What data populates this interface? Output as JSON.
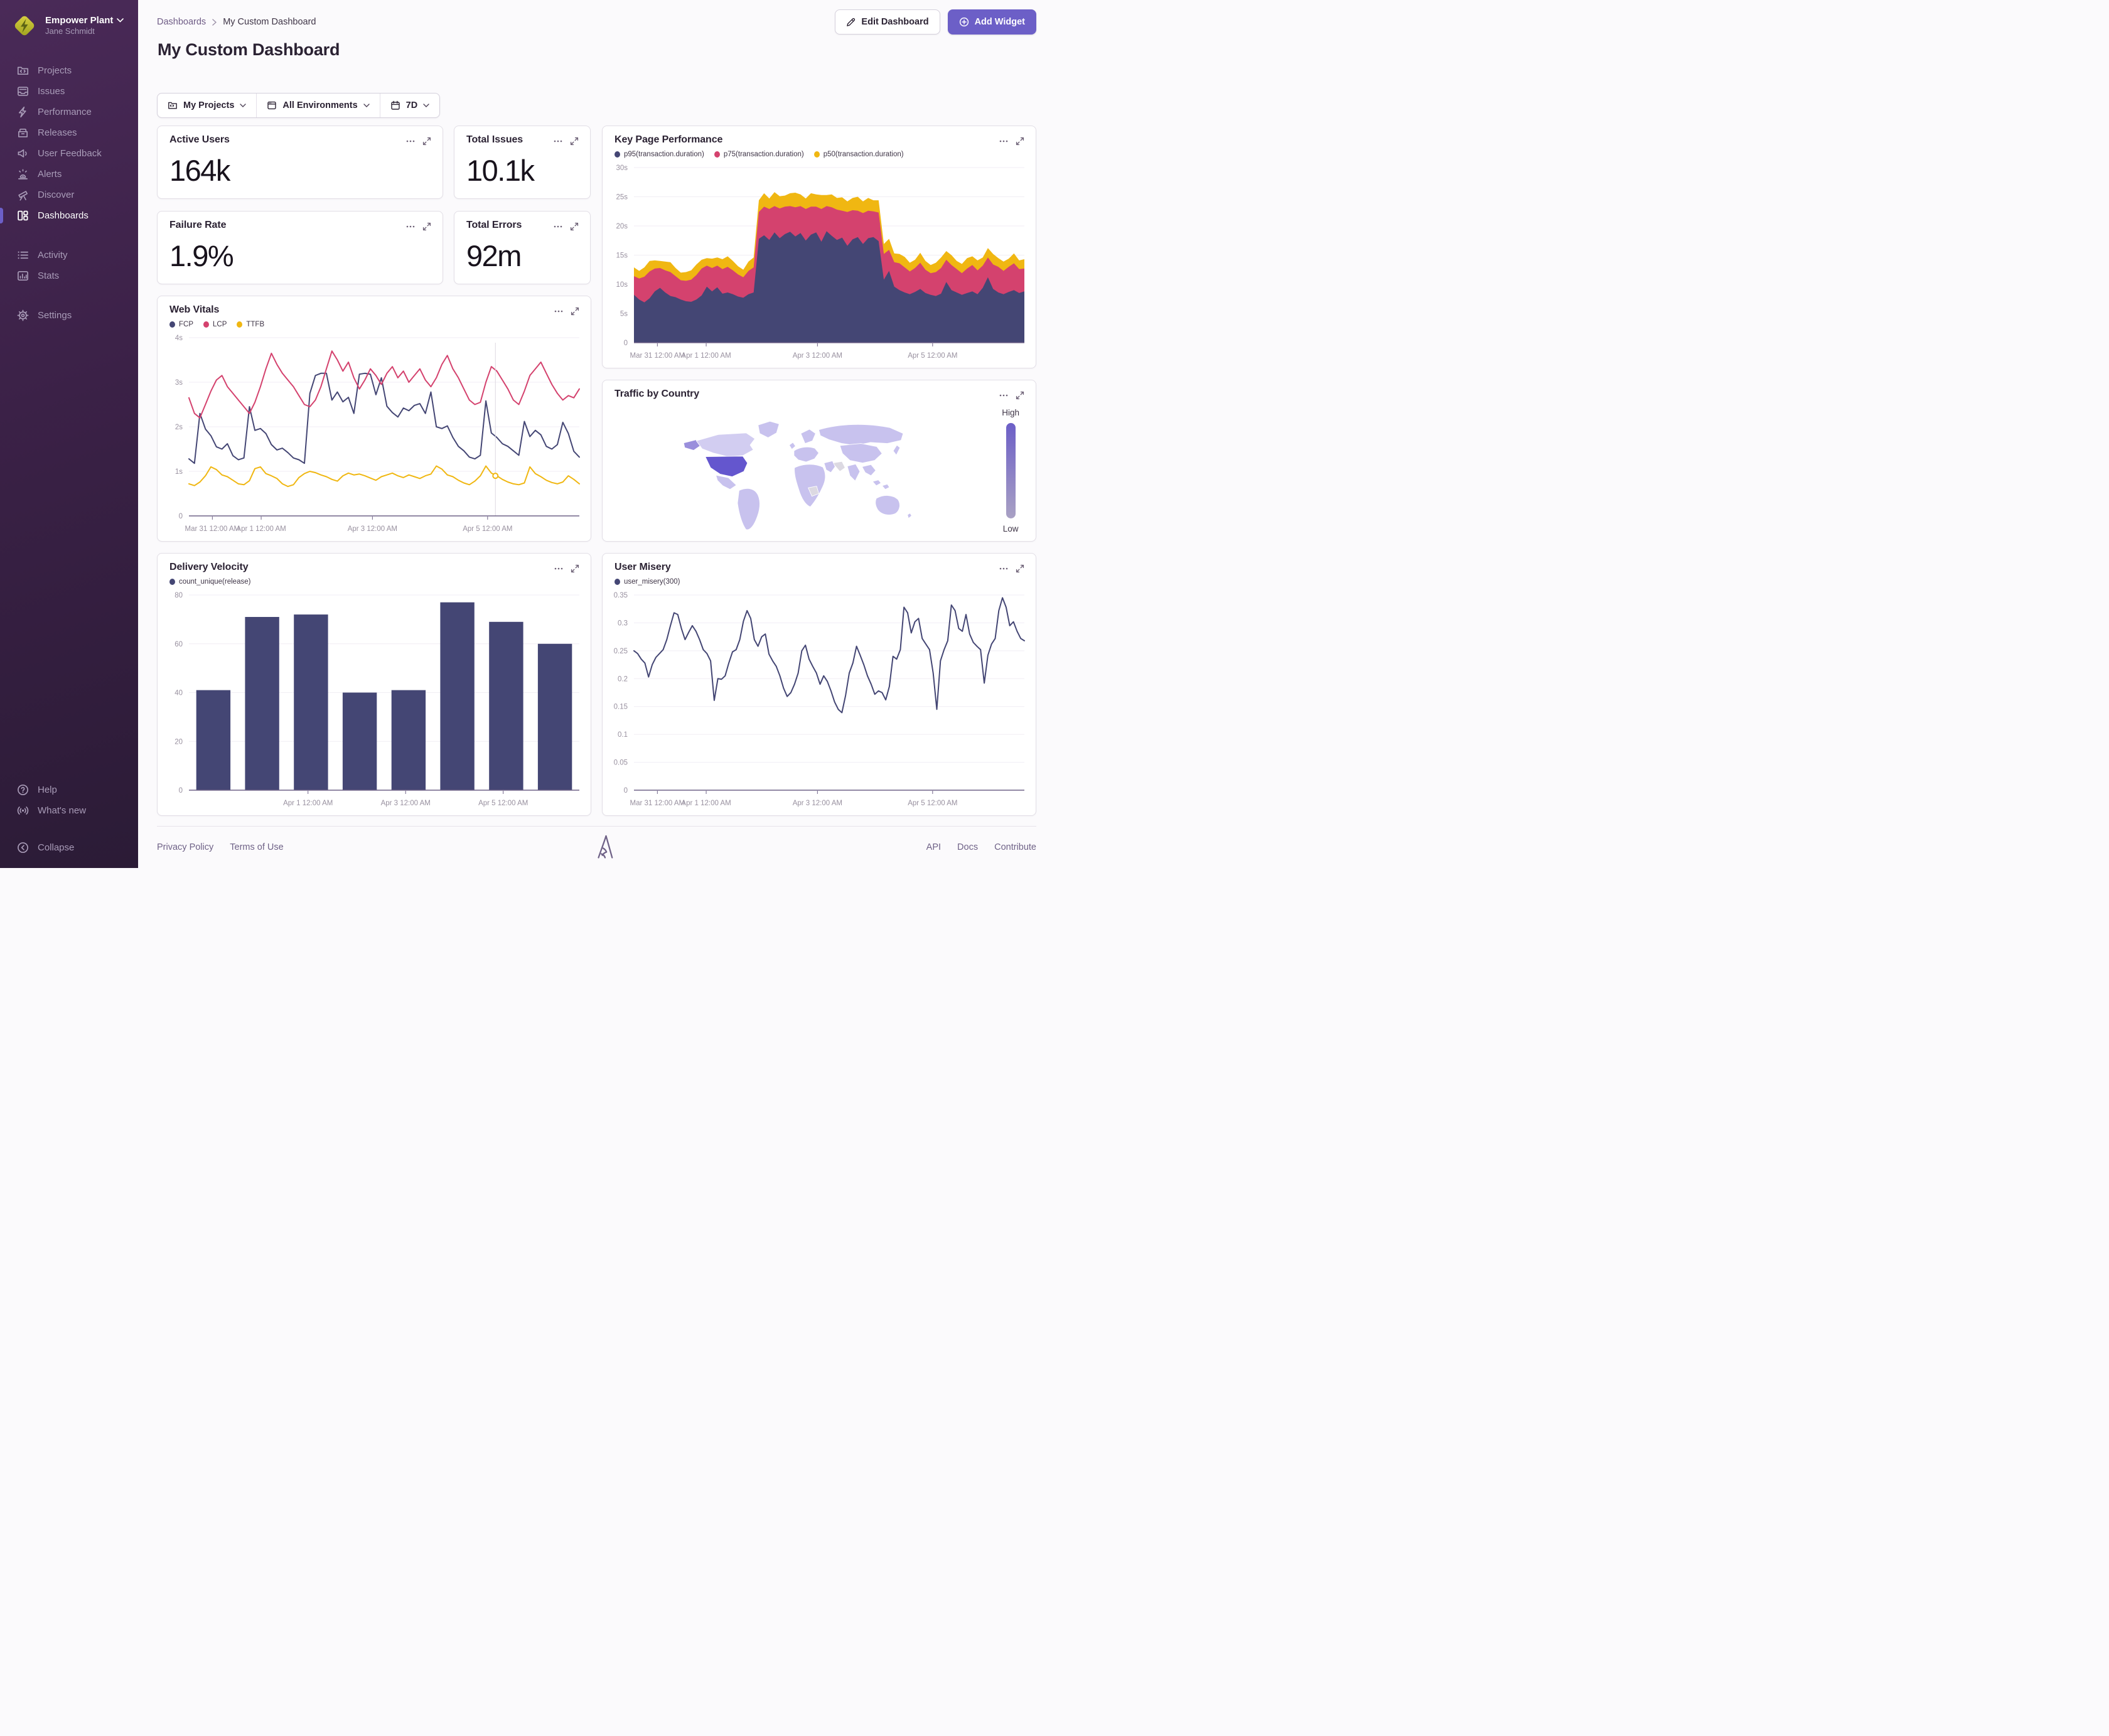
{
  "colors": {
    "accent": "#6C5FC7",
    "series_navy": "#444674",
    "series_pink": "#D4426E",
    "series_gold": "#F0B712",
    "map_base": "#C8C2EE",
    "map_light": "#D2CDF1",
    "map_medium": "#9A8FDC",
    "map_high": "#6456CE",
    "map_gray": "#DCD9E2",
    "legend_high": "#6C5FC7",
    "legend_low": "#A9A1C4"
  },
  "sidebar": {
    "org_name": "Empower Plant",
    "user_name": "Jane Schmidt",
    "items": [
      {
        "label": "Projects"
      },
      {
        "label": "Issues"
      },
      {
        "label": "Performance"
      },
      {
        "label": "Releases"
      },
      {
        "label": "User Feedback"
      },
      {
        "label": "Alerts"
      },
      {
        "label": "Discover"
      },
      {
        "label": "Dashboards",
        "active": true
      },
      {
        "label": "Activity"
      },
      {
        "label": "Stats"
      },
      {
        "label": "Settings"
      }
    ],
    "footer_items": [
      {
        "label": "Help"
      },
      {
        "label": "What's new"
      },
      {
        "label": "Collapse"
      }
    ]
  },
  "header": {
    "breadcrumb_parent": "Dashboards",
    "breadcrumb_current": "My Custom Dashboard",
    "title": "My Custom Dashboard",
    "edit_button": "Edit Dashboard",
    "add_button": "Add Widget"
  },
  "filters": {
    "projects": "My Projects",
    "environments": "All Environments",
    "date_range": "7D"
  },
  "widgets": {
    "active_users": {
      "title": "Active Users",
      "value": "164k"
    },
    "total_issues": {
      "title": "Total Issues",
      "value": "10.1k"
    },
    "failure_rate": {
      "title": "Failure Rate",
      "value": "1.9%"
    },
    "total_errors": {
      "title": "Total Errors",
      "value": "92m"
    }
  },
  "chart_data": [
    {
      "id": "key_page_performance",
      "title": "Key Page Performance",
      "type": "area",
      "stacked": true,
      "ylim": [
        0,
        30
      ],
      "y_ticks": [
        {
          "v": 0,
          "label": "0"
        },
        {
          "v": 5,
          "label": "5s"
        },
        {
          "v": 10,
          "label": "10s"
        },
        {
          "v": 15,
          "label": "15s"
        },
        {
          "v": 20,
          "label": "20s"
        },
        {
          "v": 25,
          "label": "25s"
        },
        {
          "v": 30,
          "label": "30s"
        }
      ],
      "x_ticks": [
        {
          "f": 0.06,
          "label": "Mar 31 12:00 AM"
        },
        {
          "f": 0.185,
          "label": "Apr 1 12:00 AM"
        },
        {
          "f": 0.47,
          "label": "Apr 3 12:00 AM"
        },
        {
          "f": 0.765,
          "label": "Apr 5 12:00 AM"
        }
      ],
      "series": [
        {
          "name": "p95(transaction.duration)",
          "color": "#444674",
          "values": [
            8.2,
            7.4,
            6.9,
            7.6,
            8.8,
            9.4,
            8.6,
            8.0,
            7.8,
            7.4,
            7.1,
            7.0,
            7.4,
            8.1,
            9.6,
            8.8,
            9.5,
            8.4,
            8.6,
            8.3,
            7.9,
            7.7,
            8.3,
            8.6,
            17.8,
            18.4,
            17.6,
            18.9,
            17.9,
            18.6,
            19.0,
            18.2,
            18.8,
            17.5,
            18.5,
            18.9,
            17.3,
            19.1,
            18.3,
            17.6,
            18.0,
            16.6,
            17.7,
            18.1,
            16.9,
            17.9,
            18.1,
            17.4,
            10.8,
            12.3,
            9.6,
            9.0,
            8.6,
            8.3,
            8.7,
            9.2,
            8.5,
            8.2,
            8.0,
            8.4,
            10.4,
            9.0,
            8.6,
            8.2,
            8.5,
            8.8,
            8.3,
            9.4,
            11.2,
            9.2,
            8.6,
            8.3,
            8.7,
            9.0,
            8.5,
            8.8
          ]
        },
        {
          "name": "p75(transaction.duration)",
          "color": "#D4426E",
          "values": [
            3.2,
            3.6,
            4.4,
            4.6,
            3.9,
            3.4,
            3.8,
            4.1,
            3.6,
            3.3,
            3.5,
            3.8,
            4.2,
            4.6,
            3.6,
            4.0,
            3.7,
            4.2,
            4.4,
            4.1,
            3.8,
            3.5,
            4.0,
            4.3,
            4.6,
            4.9,
            5.3,
            4.5,
            5.1,
            4.7,
            4.4,
            5.0,
            4.6,
            5.4,
            4.8,
            4.4,
            5.6,
            4.3,
            4.9,
            5.2,
            4.6,
            5.8,
            5.0,
            4.5,
            5.3,
            4.7,
            4.4,
            4.9,
            4.4,
            3.6,
            4.2,
            4.6,
            4.3,
            3.9,
            4.1,
            4.5,
            4.0,
            3.7,
            4.1,
            4.4,
            3.8,
            4.3,
            4.0,
            3.7,
            4.2,
            4.5,
            4.1,
            3.8,
            3.4,
            4.2,
            4.4,
            4.0,
            4.3,
            4.6,
            4.1,
            3.9
          ]
        },
        {
          "name": "p50(transaction.duration)",
          "color": "#F0B712",
          "values": [
            1.5,
            1.3,
            1.6,
            1.8,
            1.4,
            1.2,
            1.5,
            1.7,
            1.4,
            1.3,
            1.5,
            1.6,
            1.8,
            1.5,
            1.3,
            1.6,
            1.4,
            1.7,
            1.8,
            1.6,
            1.4,
            1.3,
            1.6,
            1.7,
            2.0,
            2.3,
            1.8,
            2.4,
            2.1,
            1.9,
            2.2,
            2.5,
            2.0,
            1.8,
            2.3,
            2.1,
            2.4,
            1.9,
            2.2,
            2.0,
            2.3,
            1.8,
            2.1,
            2.4,
            2.0,
            2.2,
            1.9,
            2.1,
            1.7,
            1.9,
            1.5,
            1.6,
            1.8,
            1.5,
            1.4,
            1.7,
            1.5,
            1.4,
            1.6,
            1.8,
            1.5,
            1.7,
            1.4,
            1.6,
            1.8,
            1.5,
            1.7,
            1.4,
            1.6,
            1.8,
            1.5,
            1.6,
            1.4,
            1.7,
            1.5,
            1.6
          ]
        }
      ]
    },
    {
      "id": "web_vitals",
      "title": "Web Vitals",
      "type": "line",
      "ylim": [
        0,
        4
      ],
      "y_ticks": [
        {
          "v": 0,
          "label": "0"
        },
        {
          "v": 1,
          "label": "1s"
        },
        {
          "v": 2,
          "label": "2s"
        },
        {
          "v": 3,
          "label": "3s"
        },
        {
          "v": 4,
          "label": "4s"
        }
      ],
      "x_ticks": [
        {
          "f": 0.06,
          "label": "Mar 31 12:00 AM"
        },
        {
          "f": 0.185,
          "label": "Apr 1 12:00 AM"
        },
        {
          "f": 0.47,
          "label": "Apr 3 12:00 AM"
        },
        {
          "f": 0.765,
          "label": "Apr 5 12:00 AM"
        }
      ],
      "cursor": {
        "f": 0.785,
        "series": 2
      },
      "series": [
        {
          "name": "FCP",
          "color": "#444674",
          "values": [
            1.28,
            1.18,
            2.3,
            1.95,
            1.8,
            1.55,
            1.5,
            1.62,
            1.35,
            1.26,
            1.3,
            2.45,
            1.92,
            1.96,
            1.85,
            1.6,
            1.48,
            1.52,
            1.42,
            1.3,
            1.26,
            1.18,
            2.75,
            3.15,
            3.2,
            3.2,
            2.6,
            2.78,
            2.56,
            2.66,
            2.3,
            3.18,
            3.2,
            3.18,
            2.72,
            3.1,
            2.46,
            2.32,
            2.22,
            2.42,
            2.36,
            2.48,
            2.52,
            2.3,
            2.78,
            2.0,
            1.96,
            2.02,
            1.76,
            1.56,
            1.46,
            1.32,
            1.28,
            1.36,
            2.58,
            1.86,
            1.76,
            1.62,
            1.56,
            1.46,
            1.36,
            2.12,
            1.78,
            1.92,
            1.82,
            1.56,
            1.5,
            1.6,
            2.1,
            1.85,
            1.45,
            1.32
          ]
        },
        {
          "name": "LCP",
          "color": "#D4426E",
          "values": [
            2.65,
            2.3,
            2.2,
            2.5,
            2.8,
            3.05,
            3.15,
            2.9,
            2.75,
            2.6,
            2.45,
            2.3,
            2.55,
            2.9,
            3.3,
            3.65,
            3.4,
            3.2,
            3.05,
            2.9,
            2.7,
            2.5,
            2.45,
            2.6,
            2.9,
            3.3,
            3.7,
            3.5,
            3.25,
            3.45,
            3.1,
            2.85,
            3.05,
            3.3,
            3.15,
            2.95,
            3.2,
            3.35,
            3.1,
            3.25,
            3.0,
            3.15,
            3.3,
            3.05,
            2.9,
            3.1,
            3.4,
            3.6,
            3.3,
            3.1,
            2.85,
            2.6,
            2.5,
            2.55,
            3.0,
            3.35,
            3.25,
            3.05,
            2.85,
            2.6,
            2.5,
            2.8,
            3.15,
            3.3,
            3.45,
            3.2,
            2.95,
            2.75,
            2.6,
            2.7,
            2.65,
            2.85
          ]
        },
        {
          "name": "TTFB",
          "color": "#F0B712",
          "values": [
            0.72,
            0.68,
            0.76,
            0.9,
            1.1,
            1.04,
            0.92,
            0.88,
            0.8,
            0.72,
            0.7,
            0.79,
            1.06,
            1.1,
            0.95,
            0.9,
            0.84,
            0.72,
            0.66,
            0.7,
            0.86,
            0.95,
            1.0,
            0.97,
            0.92,
            0.88,
            0.82,
            0.78,
            0.9,
            0.96,
            0.92,
            0.94,
            0.9,
            0.85,
            0.8,
            0.88,
            0.92,
            0.96,
            0.9,
            0.86,
            0.92,
            0.88,
            0.84,
            0.9,
            0.94,
            1.12,
            1.05,
            0.92,
            0.88,
            0.8,
            0.74,
            0.7,
            0.78,
            0.9,
            1.12,
            0.96,
            0.9,
            0.82,
            0.76,
            0.72,
            0.7,
            0.74,
            1.1,
            0.95,
            0.88,
            0.8,
            0.75,
            0.72,
            0.76,
            0.9,
            0.82,
            0.72
          ]
        }
      ]
    },
    {
      "id": "traffic_by_country",
      "title": "Traffic by Country",
      "type": "map",
      "legend_high": "High",
      "legend_low": "Low",
      "highlight_country": "United States"
    },
    {
      "id": "delivery_velocity",
      "title": "Delivery Velocity",
      "type": "bar",
      "ylim": [
        0,
        80
      ],
      "y_ticks": [
        {
          "v": 0,
          "label": "0"
        },
        {
          "v": 20,
          "label": "20"
        },
        {
          "v": 40,
          "label": "40"
        },
        {
          "v": 60,
          "label": "60"
        },
        {
          "v": 80,
          "label": "80"
        }
      ],
      "x_ticks": [
        {
          "f": 0.305,
          "label": "Apr 1 12:00 AM"
        },
        {
          "f": 0.555,
          "label": "Apr 3 12:00 AM"
        },
        {
          "f": 0.805,
          "label": "Apr 5 12:00 AM"
        }
      ],
      "series": [
        {
          "name": "count_unique(release)",
          "color": "#444674",
          "values": [
            41,
            71,
            72,
            40,
            41,
            77,
            69,
            60
          ]
        }
      ]
    },
    {
      "id": "user_misery",
      "title": "User Misery",
      "type": "line",
      "ylim": [
        0,
        0.35
      ],
      "y_ticks": [
        {
          "v": 0,
          "label": "0"
        },
        {
          "v": 0.05,
          "label": "0.05"
        },
        {
          "v": 0.1,
          "label": "0.1"
        },
        {
          "v": 0.15,
          "label": "0.15"
        },
        {
          "v": 0.2,
          "label": "0.2"
        },
        {
          "v": 0.25,
          "label": "0.25"
        },
        {
          "v": 0.3,
          "label": "0.3"
        },
        {
          "v": 0.35,
          "label": "0.35"
        }
      ],
      "x_ticks": [
        {
          "f": 0.06,
          "label": "Mar 31 12:00 AM"
        },
        {
          "f": 0.185,
          "label": "Apr 1 12:00 AM"
        },
        {
          "f": 0.47,
          "label": "Apr 3 12:00 AM"
        },
        {
          "f": 0.765,
          "label": "Apr 5 12:00 AM"
        }
      ],
      "series": [
        {
          "name": "user_misery(300)",
          "color": "#444674",
          "values": [
            0.25,
            0.245,
            0.235,
            0.228,
            0.203,
            0.225,
            0.238,
            0.245,
            0.252,
            0.27,
            0.295,
            0.318,
            0.315,
            0.29,
            0.27,
            0.283,
            0.295,
            0.285,
            0.27,
            0.252,
            0.245,
            0.232,
            0.161,
            0.2,
            0.199,
            0.205,
            0.228,
            0.248,
            0.252,
            0.27,
            0.303,
            0.322,
            0.308,
            0.27,
            0.258,
            0.275,
            0.28,
            0.244,
            0.232,
            0.222,
            0.205,
            0.183,
            0.168,
            0.175,
            0.19,
            0.21,
            0.25,
            0.26,
            0.235,
            0.222,
            0.21,
            0.19,
            0.205,
            0.195,
            0.178,
            0.158,
            0.145,
            0.139,
            0.17,
            0.21,
            0.228,
            0.258,
            0.242,
            0.225,
            0.205,
            0.19,
            0.172,
            0.178,
            0.175,
            0.162,
            0.186,
            0.24,
            0.235,
            0.252,
            0.328,
            0.318,
            0.282,
            0.302,
            0.308,
            0.272,
            0.262,
            0.252,
            0.21,
            0.145,
            0.232,
            0.252,
            0.268,
            0.332,
            0.322,
            0.29,
            0.285,
            0.315,
            0.28,
            0.265,
            0.258,
            0.252,
            0.192,
            0.242,
            0.262,
            0.272,
            0.322,
            0.345,
            0.328,
            0.295,
            0.302,
            0.285,
            0.272,
            0.268
          ]
        }
      ]
    }
  ],
  "footer": {
    "links_left": [
      "Privacy Policy",
      "Terms of Use"
    ],
    "links_right": [
      "API",
      "Docs",
      "Contribute"
    ]
  }
}
